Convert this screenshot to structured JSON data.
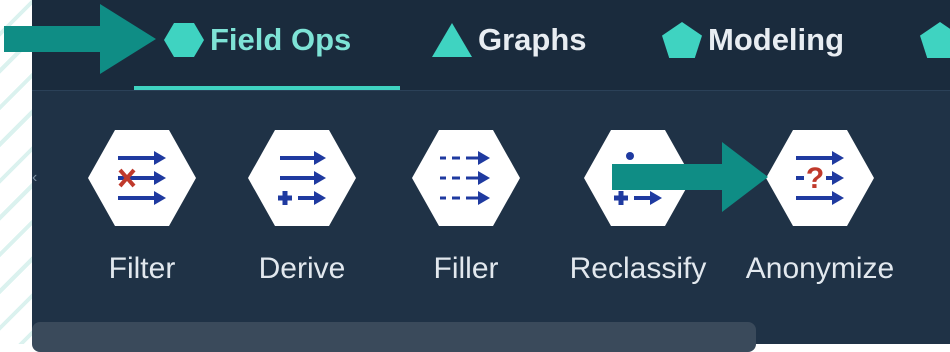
{
  "tabs": [
    {
      "label": "Field Ops",
      "icon": "hexagon-icon",
      "active": true
    },
    {
      "label": "Graphs",
      "icon": "triangle-icon",
      "active": false
    },
    {
      "label": "Modeling",
      "icon": "pentagon-icon",
      "active": false
    }
  ],
  "nodes": [
    {
      "label": "Filter",
      "icon": "filter-node-icon"
    },
    {
      "label": "Derive",
      "icon": "derive-node-icon"
    },
    {
      "label": "Filler",
      "icon": "filler-node-icon"
    },
    {
      "label": "Reclassify",
      "icon": "reclassify-node-icon"
    },
    {
      "label": "Anonymize",
      "icon": "anonymize-node-icon"
    }
  ],
  "colors": {
    "accent": "#3fd3c1",
    "background": "#1f3246",
    "arrow": "#0f8d85",
    "icon_blue": "#1f3aa0",
    "icon_red": "#c0392b"
  }
}
